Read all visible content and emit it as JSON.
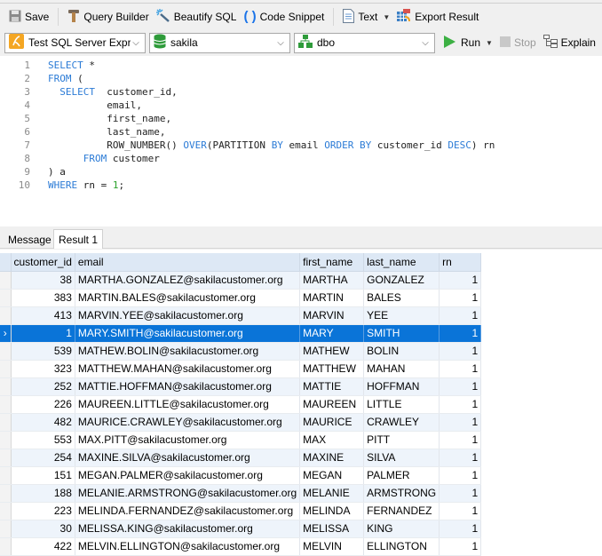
{
  "toolbar": {
    "save": "Save",
    "query_builder": "Query Builder",
    "beautify_sql": "Beautify SQL",
    "code_snippet": "Code Snippet",
    "text": "Text",
    "export_result": "Export Result"
  },
  "connection_bar": {
    "connection": "Test SQL Server Expres",
    "database": "sakila",
    "schema": "dbo",
    "run": "Run",
    "stop": "Stop",
    "explain": "Explain"
  },
  "editor": {
    "line_numbers": [
      "1",
      "2",
      "3",
      "4",
      "5",
      "6",
      "7",
      "8",
      "9",
      "10"
    ],
    "lines": [
      [
        {
          "t": "kw",
          "v": "SELECT"
        },
        {
          "t": "txt",
          "v": " *"
        }
      ],
      [
        {
          "t": "kw",
          "v": "FROM"
        },
        {
          "t": "txt",
          "v": " ("
        }
      ],
      [
        {
          "t": "txt",
          "v": "  "
        },
        {
          "t": "kw",
          "v": "SELECT"
        },
        {
          "t": "txt",
          "v": "  customer_id,"
        }
      ],
      [
        {
          "t": "txt",
          "v": "          email,"
        }
      ],
      [
        {
          "t": "txt",
          "v": "          first_name,"
        }
      ],
      [
        {
          "t": "txt",
          "v": "          last_name,"
        }
      ],
      [
        {
          "t": "txt",
          "v": "          ROW_NUMBER() "
        },
        {
          "t": "kw",
          "v": "OVER"
        },
        {
          "t": "txt",
          "v": "(PARTITION "
        },
        {
          "t": "kw",
          "v": "BY"
        },
        {
          "t": "txt",
          "v": " email "
        },
        {
          "t": "kw",
          "v": "ORDER BY"
        },
        {
          "t": "txt",
          "v": " customer_id "
        },
        {
          "t": "kw",
          "v": "DESC"
        },
        {
          "t": "txt",
          "v": ") rn"
        }
      ],
      [
        {
          "t": "txt",
          "v": "      "
        },
        {
          "t": "kw",
          "v": "FROM"
        },
        {
          "t": "txt",
          "v": " customer"
        }
      ],
      [
        {
          "t": "txt",
          "v": ") a"
        }
      ],
      [
        {
          "t": "kw",
          "v": "WHERE"
        },
        {
          "t": "txt",
          "v": " rn = "
        },
        {
          "t": "num",
          "v": "1"
        },
        {
          "t": "txt",
          "v": ";"
        }
      ]
    ]
  },
  "result_tabs": [
    "Message",
    "Result 1"
  ],
  "active_tab": "Result 1",
  "grid": {
    "columns": [
      "customer_id",
      "email",
      "first_name",
      "last_name",
      "rn"
    ],
    "selected_row": 3,
    "rows": [
      [
        "38",
        "MARTHA.GONZALEZ@sakilacustomer.org",
        "MARTHA",
        "GONZALEZ",
        "1"
      ],
      [
        "383",
        "MARTIN.BALES@sakilacustomer.org",
        "MARTIN",
        "BALES",
        "1"
      ],
      [
        "413",
        "MARVIN.YEE@sakilacustomer.org",
        "MARVIN",
        "YEE",
        "1"
      ],
      [
        "1",
        "MARY.SMITH@sakilacustomer.org",
        "MARY",
        "SMITH",
        "1"
      ],
      [
        "539",
        "MATHEW.BOLIN@sakilacustomer.org",
        "MATHEW",
        "BOLIN",
        "1"
      ],
      [
        "323",
        "MATTHEW.MAHAN@sakilacustomer.org",
        "MATTHEW",
        "MAHAN",
        "1"
      ],
      [
        "252",
        "MATTIE.HOFFMAN@sakilacustomer.org",
        "MATTIE",
        "HOFFMAN",
        "1"
      ],
      [
        "226",
        "MAUREEN.LITTLE@sakilacustomer.org",
        "MAUREEN",
        "LITTLE",
        "1"
      ],
      [
        "482",
        "MAURICE.CRAWLEY@sakilacustomer.org",
        "MAURICE",
        "CRAWLEY",
        "1"
      ],
      [
        "553",
        "MAX.PITT@sakilacustomer.org",
        "MAX",
        "PITT",
        "1"
      ],
      [
        "254",
        "MAXINE.SILVA@sakilacustomer.org",
        "MAXINE",
        "SILVA",
        "1"
      ],
      [
        "151",
        "MEGAN.PALMER@sakilacustomer.org",
        "MEGAN",
        "PALMER",
        "1"
      ],
      [
        "188",
        "MELANIE.ARMSTRONG@sakilacustomer.org",
        "MELANIE",
        "ARMSTRONG",
        "1"
      ],
      [
        "223",
        "MELINDA.FERNANDEZ@sakilacustomer.org",
        "MELINDA",
        "FERNANDEZ",
        "1"
      ],
      [
        "30",
        "MELISSA.KING@sakilacustomer.org",
        "MELISSA",
        "KING",
        "1"
      ],
      [
        "422",
        "MELVIN.ELLINGTON@sakilacustomer.org",
        "MELVIN",
        "ELLINGTON",
        "1"
      ]
    ]
  },
  "colors": {
    "keyword": "#2b7bd6",
    "number": "#2aa12a",
    "selection": "#0a74d8",
    "header_bg": "#dde8f5",
    "run_green": "#3cb043"
  }
}
